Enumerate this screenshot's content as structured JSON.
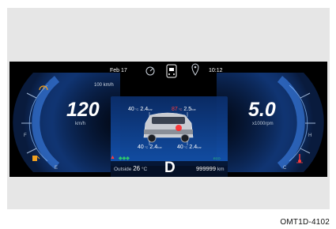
{
  "top_bar": {
    "date": "Feb  17",
    "time": "10:12",
    "icons": [
      "dial-icon",
      "car-icon",
      "location-pin-icon"
    ]
  },
  "speed": {
    "value": "120",
    "unit": "km/h",
    "limit_label": "100 km/h",
    "gauge_fraction": 0.6,
    "scale_left": "F",
    "scale_bottom": "E"
  },
  "rpm": {
    "value": "5.0",
    "unit": "x1000rpm",
    "gauge_fraction": 0.62,
    "scale_right": "H",
    "scale_bottom": "C"
  },
  "tires": {
    "front_left": {
      "value": "40",
      "unit_prefix": "°C",
      "pressure": "2.4",
      "pressure_unit": "bar"
    },
    "front_right": {
      "value": "87",
      "unit_prefix": "°C",
      "pressure": "2.5",
      "pressure_unit": "bar"
    },
    "rear_left": {
      "value": "40",
      "unit_prefix": "°C",
      "pressure": "2.4",
      "pressure_unit": "bar"
    },
    "rear_right": {
      "value": "40",
      "unit_prefix": "°C",
      "pressure": "2.4",
      "pressure_unit": "bar"
    }
  },
  "bottom": {
    "outside_label": "Outside",
    "outside_value": "26",
    "outside_unit": "°C",
    "gear": "D",
    "odometer": "999999",
    "odometer_unit": "km",
    "eco_label": "ECO"
  },
  "caption": "OMT1D-4102",
  "colors": {
    "background": "#000000",
    "gauge_blue": "#1e6fd8",
    "center_panel": "#0f3d86",
    "warning_red": "#ff3b3b",
    "indicator_green": "#2fd06a",
    "warning_amber": "#f0a020"
  }
}
